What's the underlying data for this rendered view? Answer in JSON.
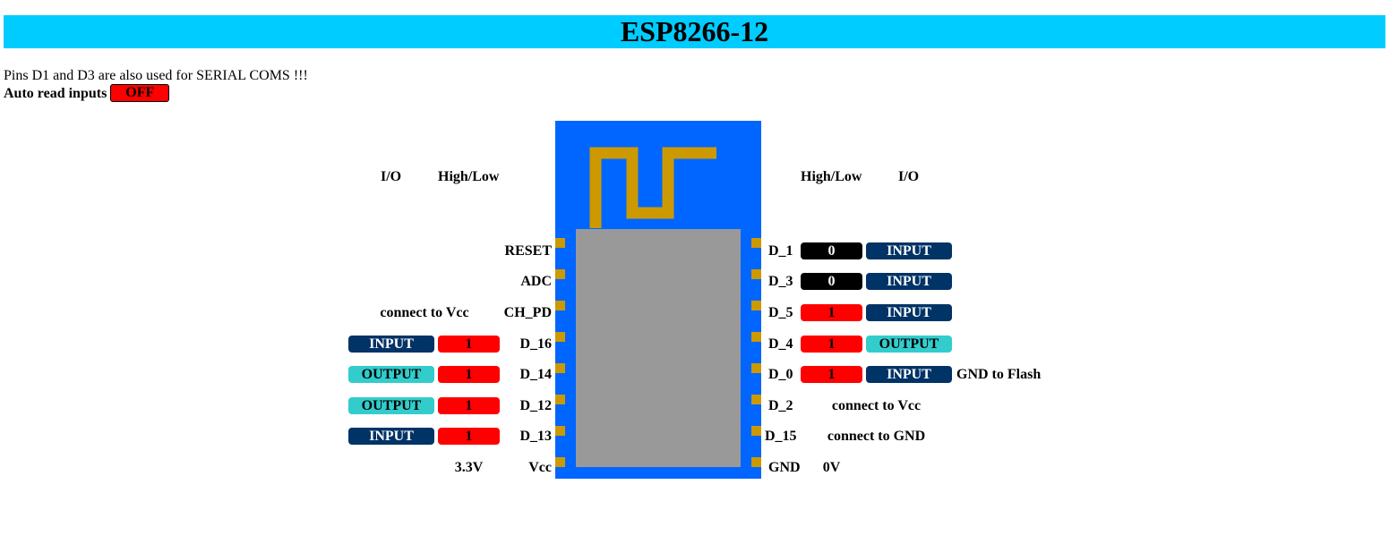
{
  "header": {
    "title": "ESP8266-12"
  },
  "note": "Pins D1 and D3 are also used for SERIAL COMS !!!",
  "auto_read": {
    "label": "Auto read inputs",
    "state": "OFF",
    "color": "#ff0000"
  },
  "colors": {
    "high": "#ff0000",
    "low": "#000000",
    "input": "#003366",
    "output": "#33cccc",
    "module": "#0066ff",
    "antenna": "#cc9900",
    "shield": "#999999",
    "title_bar": "#00ccff"
  },
  "headers": {
    "left": {
      "io": "I/O",
      "level": "High/Low"
    },
    "right": {
      "level": "High/Low",
      "io": "I/O"
    }
  },
  "left_pins": [
    {
      "name": "RESET"
    },
    {
      "name": "ADC"
    },
    {
      "name": "CH_PD",
      "note": "connect to Vcc"
    },
    {
      "name": "D_16",
      "value": "1",
      "mode": "INPUT"
    },
    {
      "name": "D_14",
      "value": "1",
      "mode": "OUTPUT"
    },
    {
      "name": "D_12",
      "value": "1",
      "mode": "OUTPUT"
    },
    {
      "name": "D_13",
      "value": "1",
      "mode": "INPUT"
    },
    {
      "name": "Vcc",
      "note": "3.3V"
    }
  ],
  "right_pins": [
    {
      "name": "D_1",
      "value": "0",
      "mode": "INPUT"
    },
    {
      "name": "D_3",
      "value": "0",
      "mode": "INPUT"
    },
    {
      "name": "D_5",
      "value": "1",
      "mode": "INPUT"
    },
    {
      "name": "D_4",
      "value": "1",
      "mode": "OUTPUT"
    },
    {
      "name": "D_0",
      "value": "1",
      "mode": "INPUT",
      "note": "GND to Flash"
    },
    {
      "name": "D_2",
      "note": "connect to Vcc"
    },
    {
      "name": "D_15",
      "note": "connect to GND"
    },
    {
      "name": "GND",
      "note": "0V"
    }
  ]
}
